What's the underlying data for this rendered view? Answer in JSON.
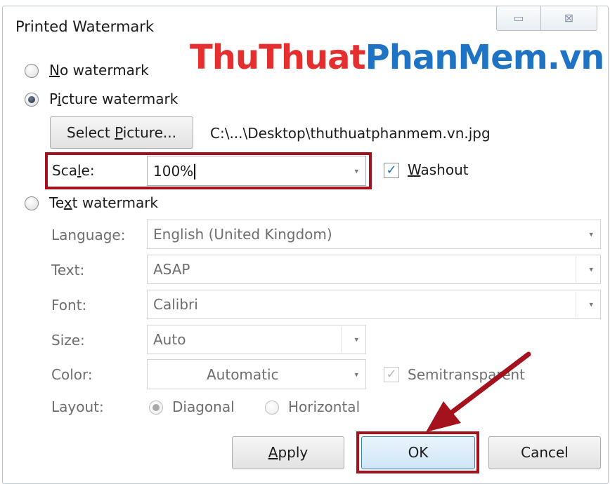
{
  "window": {
    "title": "Printed Watermark",
    "minimize_symbol": "▭",
    "close_symbol": "⊠"
  },
  "overlay": {
    "watermark_part1": "ThuThuat",
    "watermark_part2": "PhanMem.vn",
    "colors": {
      "red": "#e52f2f",
      "blue": "#1e73c4",
      "annotation": "#a3121d"
    }
  },
  "options": {
    "no_watermark": {
      "accel": "N",
      "rest": "o watermark",
      "selected": false
    },
    "picture_watermark": {
      "pre": "P",
      "accel": "i",
      "rest": "cture watermark",
      "selected": true
    },
    "text_watermark": {
      "pre": "Te",
      "accel": "x",
      "rest": "t watermark",
      "selected": false
    }
  },
  "picture": {
    "select_button": {
      "pre": "Select ",
      "accel": "P",
      "rest": "icture..."
    },
    "file_path": "C:\\...\\Desktop\\thuthuatphanmem.vn.jpg",
    "scale_label": {
      "pre": "Sca",
      "accel": "l",
      "rest": "e:"
    },
    "scale_value": "100%",
    "washout": {
      "accel": "W",
      "rest": "ashout",
      "checked": true
    }
  },
  "text": {
    "language_label": "Language:",
    "language_value": "English (United Kingdom)",
    "text_label": "Text:",
    "text_value": "ASAP",
    "font_label": "Font:",
    "font_value": "Calibri",
    "size_label": "Size:",
    "size_value": "Auto",
    "color_label": "Color:",
    "color_value": "Automatic",
    "semitransparent": {
      "label": "Semitransparent",
      "checked": true
    },
    "layout_label": "Layout:",
    "layout_diagonal": {
      "label": "Diagonal",
      "selected": true
    },
    "layout_horizontal": {
      "label": "Horizontal",
      "selected": false
    }
  },
  "buttons": {
    "apply": {
      "accel": "A",
      "rest": "pply"
    },
    "ok": "OK",
    "cancel": "Cancel"
  },
  "icons": {
    "dropdown": "▾",
    "check": "✓",
    "annotation_arrow": "arrow-pointing-to-ok"
  }
}
